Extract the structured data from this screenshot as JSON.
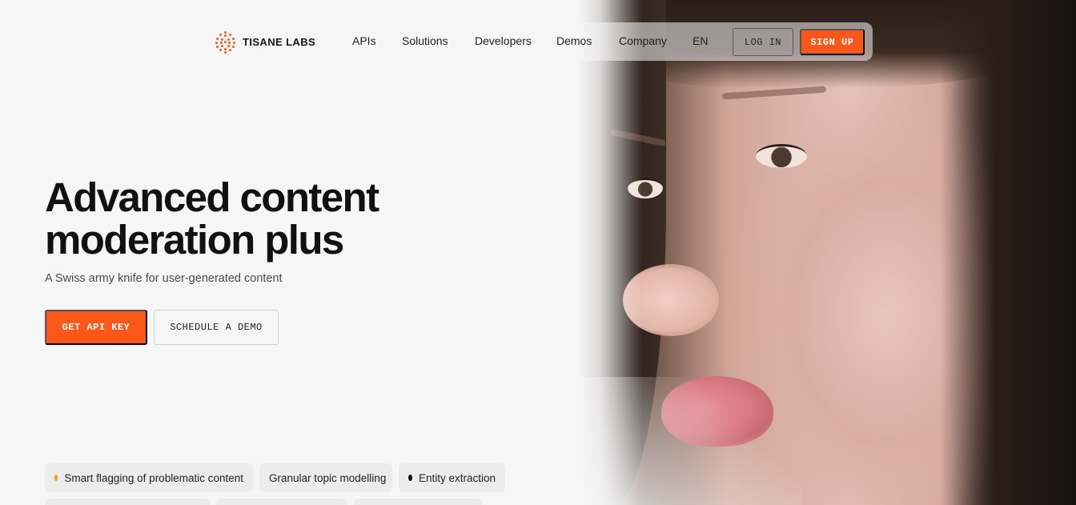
{
  "brand": {
    "name": "TISANE LABS",
    "accent": "#fa5719"
  },
  "nav": {
    "links": [
      {
        "label": "APIs",
        "id": "apis"
      },
      {
        "label": "Solutions",
        "id": "solutions"
      },
      {
        "label": "Developers",
        "id": "developers"
      },
      {
        "label": "Demos",
        "id": "demos"
      },
      {
        "label": "Company",
        "id": "company"
      },
      {
        "label": "EN",
        "id": "language"
      }
    ],
    "login_label": "LOG IN",
    "signup_label": "SIGN UP"
  },
  "hero": {
    "headline_line1": "Advanced content",
    "headline_line2": "moderation plus",
    "subheadline": "A Swiss army knife for user-generated content",
    "primary_cta": "GET API KEY",
    "secondary_cta": "SCHEDULE A DEMO",
    "image_icon": "portrait-image"
  },
  "features": [
    {
      "label": "Smart flagging of problematic content",
      "dot_color": "#f5a20a"
    },
    {
      "label": "Granular topic modelling",
      "dot_color": ""
    },
    {
      "label": "Entity extraction",
      "dot_color": "#111111"
    }
  ]
}
